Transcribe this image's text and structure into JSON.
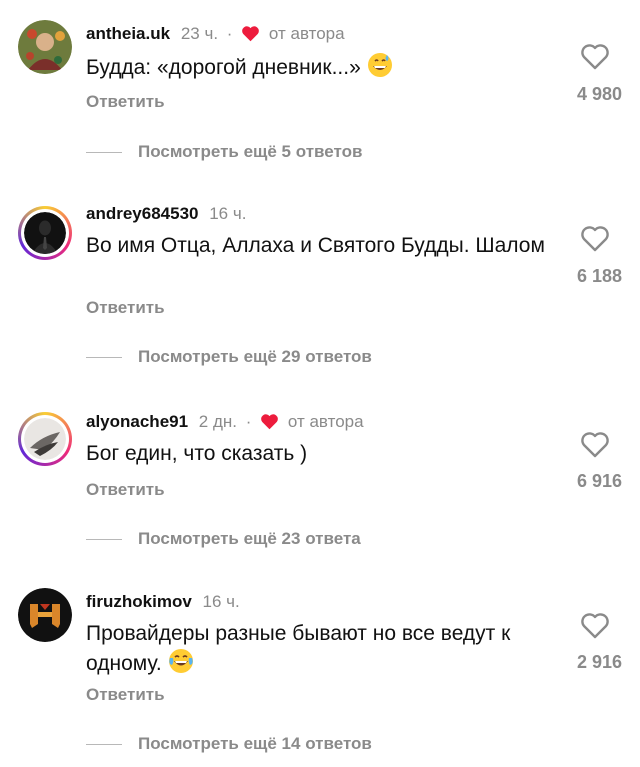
{
  "comments": [
    {
      "username": "antheia.uk",
      "time": "23 ч.",
      "author_liked": true,
      "author_label": "от автора",
      "text": "Будда: «дорогой дневник...»",
      "emoji": "grinning-sweat-emoji",
      "reply_label": "Ответить",
      "likes": "4 980",
      "view_replies": "Посмотреть ещё 5 ответов"
    },
    {
      "username": "andrey684530",
      "time": "16 ч.",
      "author_liked": false,
      "text": "Во имя Отца, Аллаха и Святого Будды. Шалом",
      "reply_label": "Ответить",
      "likes": "6 188",
      "view_replies": "Посмотреть ещё 29 ответов"
    },
    {
      "username": "alyonache91",
      "time": "2 дн.",
      "author_liked": true,
      "author_label": "от автора",
      "text": "Бог един, что сказать )",
      "reply_label": "Ответить",
      "likes": "6 916",
      "view_replies": "Посмотреть ещё 23 ответа"
    },
    {
      "username": "firuzhokimov",
      "time": "16 ч.",
      "author_liked": false,
      "text": "Провайдеры разные бывают но все ведут к одному.",
      "emoji": "tears-of-joy-emoji",
      "reply_label": "Ответить",
      "likes": "2 916",
      "view_replies": "Посмотреть ещё 14 ответов"
    }
  ],
  "colors": {
    "heart_red": "#ed1c3d",
    "muted_text": "#8a8a8a",
    "story_ring": [
      "#f9ce34",
      "#ee2a7b",
      "#6228d7"
    ]
  }
}
